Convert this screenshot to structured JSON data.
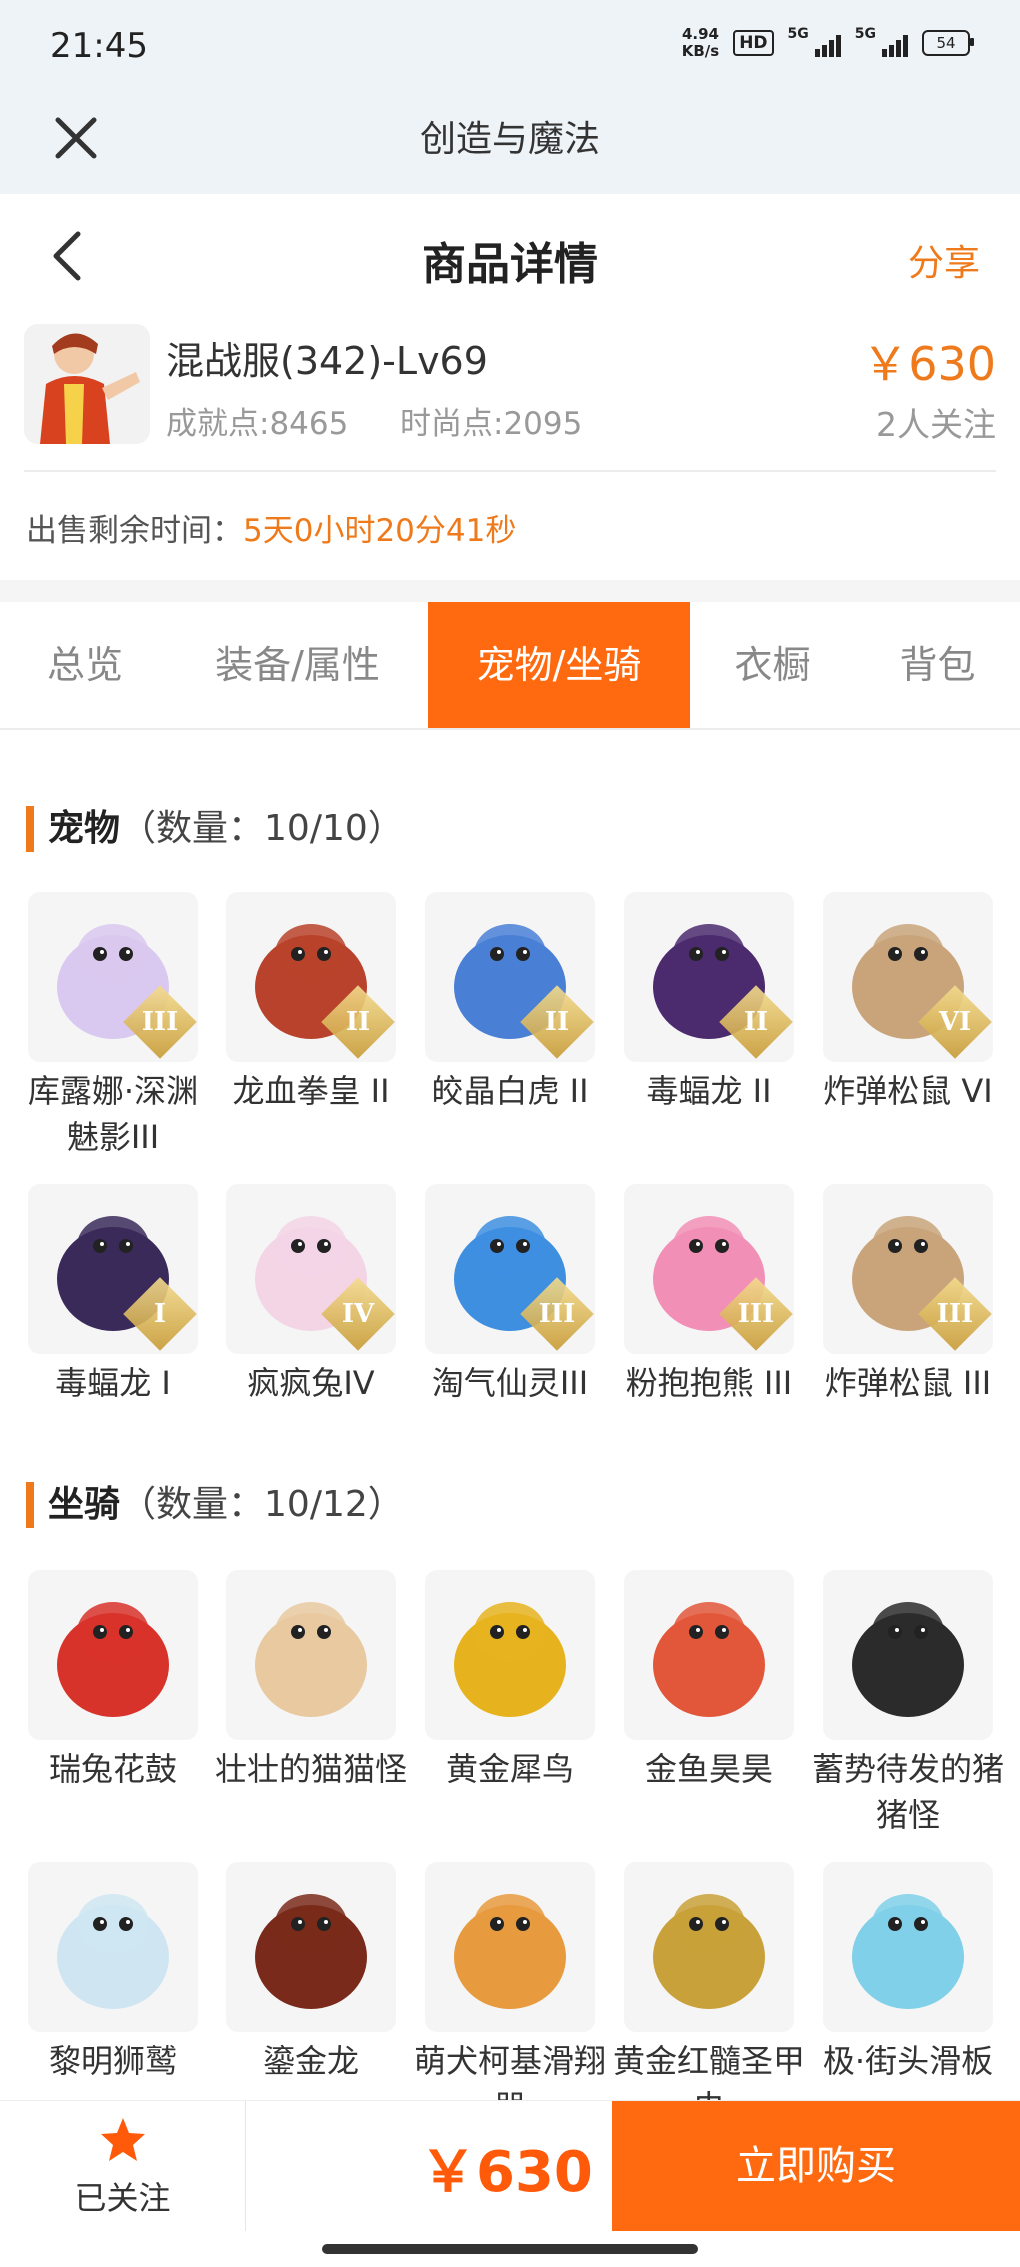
{
  "status": {
    "time": "21:45",
    "speed_top": "4.94",
    "speed_bottom": "KB/s",
    "hd": "HD",
    "net1": "5G",
    "net2": "5G",
    "battery": "54"
  },
  "app": {
    "title": "创造与魔法"
  },
  "header": {
    "title": "商品详情",
    "share": "分享"
  },
  "product": {
    "name": "混战服(342)-Lv69",
    "achievement": "成就点:8465",
    "fashion": "时尚点:2095",
    "price": "￥630",
    "watchers": "2人关注"
  },
  "remaining": {
    "label": "出售剩余时间：",
    "value": "5天0小时20分41秒"
  },
  "tabs": [
    "总览",
    "装备/属性",
    "宠物/坐骑",
    "衣橱",
    "背包"
  ],
  "active_tab": "宠物/坐骑",
  "pets": {
    "title": "宠物",
    "count": "（数量：10/10）",
    "items": [
      {
        "name": "库露娜·深渊魅影III",
        "tier": "III",
        "color": "#d9c8ef"
      },
      {
        "name": "龙血拳皇 II",
        "tier": "II",
        "color": "#b8422c"
      },
      {
        "name": "皎晶白虎 II",
        "tier": "II",
        "color": "#4a7fd6"
      },
      {
        "name": "毒蝠龙 II",
        "tier": "II",
        "color": "#4b2a6e"
      },
      {
        "name": "炸弹松鼠 VI",
        "tier": "VI",
        "color": "#c9a47a"
      },
      {
        "name": "毒蝠龙 I",
        "tier": "I",
        "color": "#3a2a5a"
      },
      {
        "name": "疯疯兔IV",
        "tier": "IV",
        "color": "#f3d5e6"
      },
      {
        "name": "淘气仙灵III",
        "tier": "III",
        "color": "#3e8fe0"
      },
      {
        "name": "粉抱抱熊 III",
        "tier": "III",
        "color": "#f28fb6"
      },
      {
        "name": "炸弹松鼠 III",
        "tier": "III",
        "color": "#c9a47a"
      }
    ]
  },
  "mounts": {
    "title": "坐骑",
    "count": "（数量：10/12）",
    "items": [
      {
        "name": "瑞兔花鼓",
        "color": "#d8332a"
      },
      {
        "name": "壮壮的猫猫怪",
        "color": "#e8c9a0"
      },
      {
        "name": "黄金犀鸟",
        "color": "#e6b31e"
      },
      {
        "name": "金鱼昊昊",
        "color": "#e2573a"
      },
      {
        "name": "蓄势待发的猪猪怪",
        "color": "#2b2b2b"
      },
      {
        "name": "黎明狮鹫",
        "color": "#cfe6f2"
      },
      {
        "name": "鎏金龙",
        "color": "#7a2a1a"
      },
      {
        "name": "萌犬柯基滑翔器",
        "color": "#e79a3e"
      },
      {
        "name": "黄金红髓圣甲虫",
        "color": "#c9a13a"
      },
      {
        "name": "极·街头滑板",
        "color": "#7fd0e8"
      }
    ]
  },
  "bottom": {
    "follow_label": "已关注",
    "price": "￥630",
    "buy_label": "立即购买"
  }
}
